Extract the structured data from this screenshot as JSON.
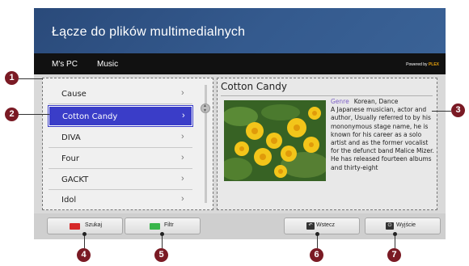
{
  "screen": {
    "title": "Łącze do plików multimedialnych",
    "breadcrumbs": [
      "M's PC",
      "Music"
    ],
    "powered_by": {
      "prefix": "Powered by",
      "brand": "PLEX"
    }
  },
  "list": {
    "items": [
      {
        "label": "Cause",
        "selected": false
      },
      {
        "label": "Cotton Candy",
        "selected": true
      },
      {
        "label": "DIVA",
        "selected": false
      },
      {
        "label": "Four",
        "selected": false
      },
      {
        "label": "GACKT",
        "selected": false
      },
      {
        "label": "Idol",
        "selected": false
      }
    ],
    "chevron": "›"
  },
  "detail": {
    "title": "Cotton Candy",
    "genre_label": "Genre",
    "genre_value": "Korean, Dance",
    "description": "A Japanese musician, actor and author, Usually referred to by his mononymous stage name, he is known for his career as a solo artist and as the former vocalist for the defunct band Malice Mizer. He has released fourteen albums and thirty-eight",
    "image": "yellow-flowers-photo"
  },
  "buttons": {
    "search": "Szukaj",
    "filter": "Filtr",
    "back": "Wstecz",
    "exit": "Wyjście"
  },
  "callouts": [
    "1",
    "2",
    "3",
    "4",
    "5",
    "6",
    "7"
  ],
  "colors": {
    "header": "#345a8e",
    "selection": "#3a3dc8",
    "callout": "#7a1a24",
    "red_key": "#d62828",
    "green_key": "#38b54a",
    "genre_label": "#7b5ec6",
    "plex": "#e5a00d"
  }
}
